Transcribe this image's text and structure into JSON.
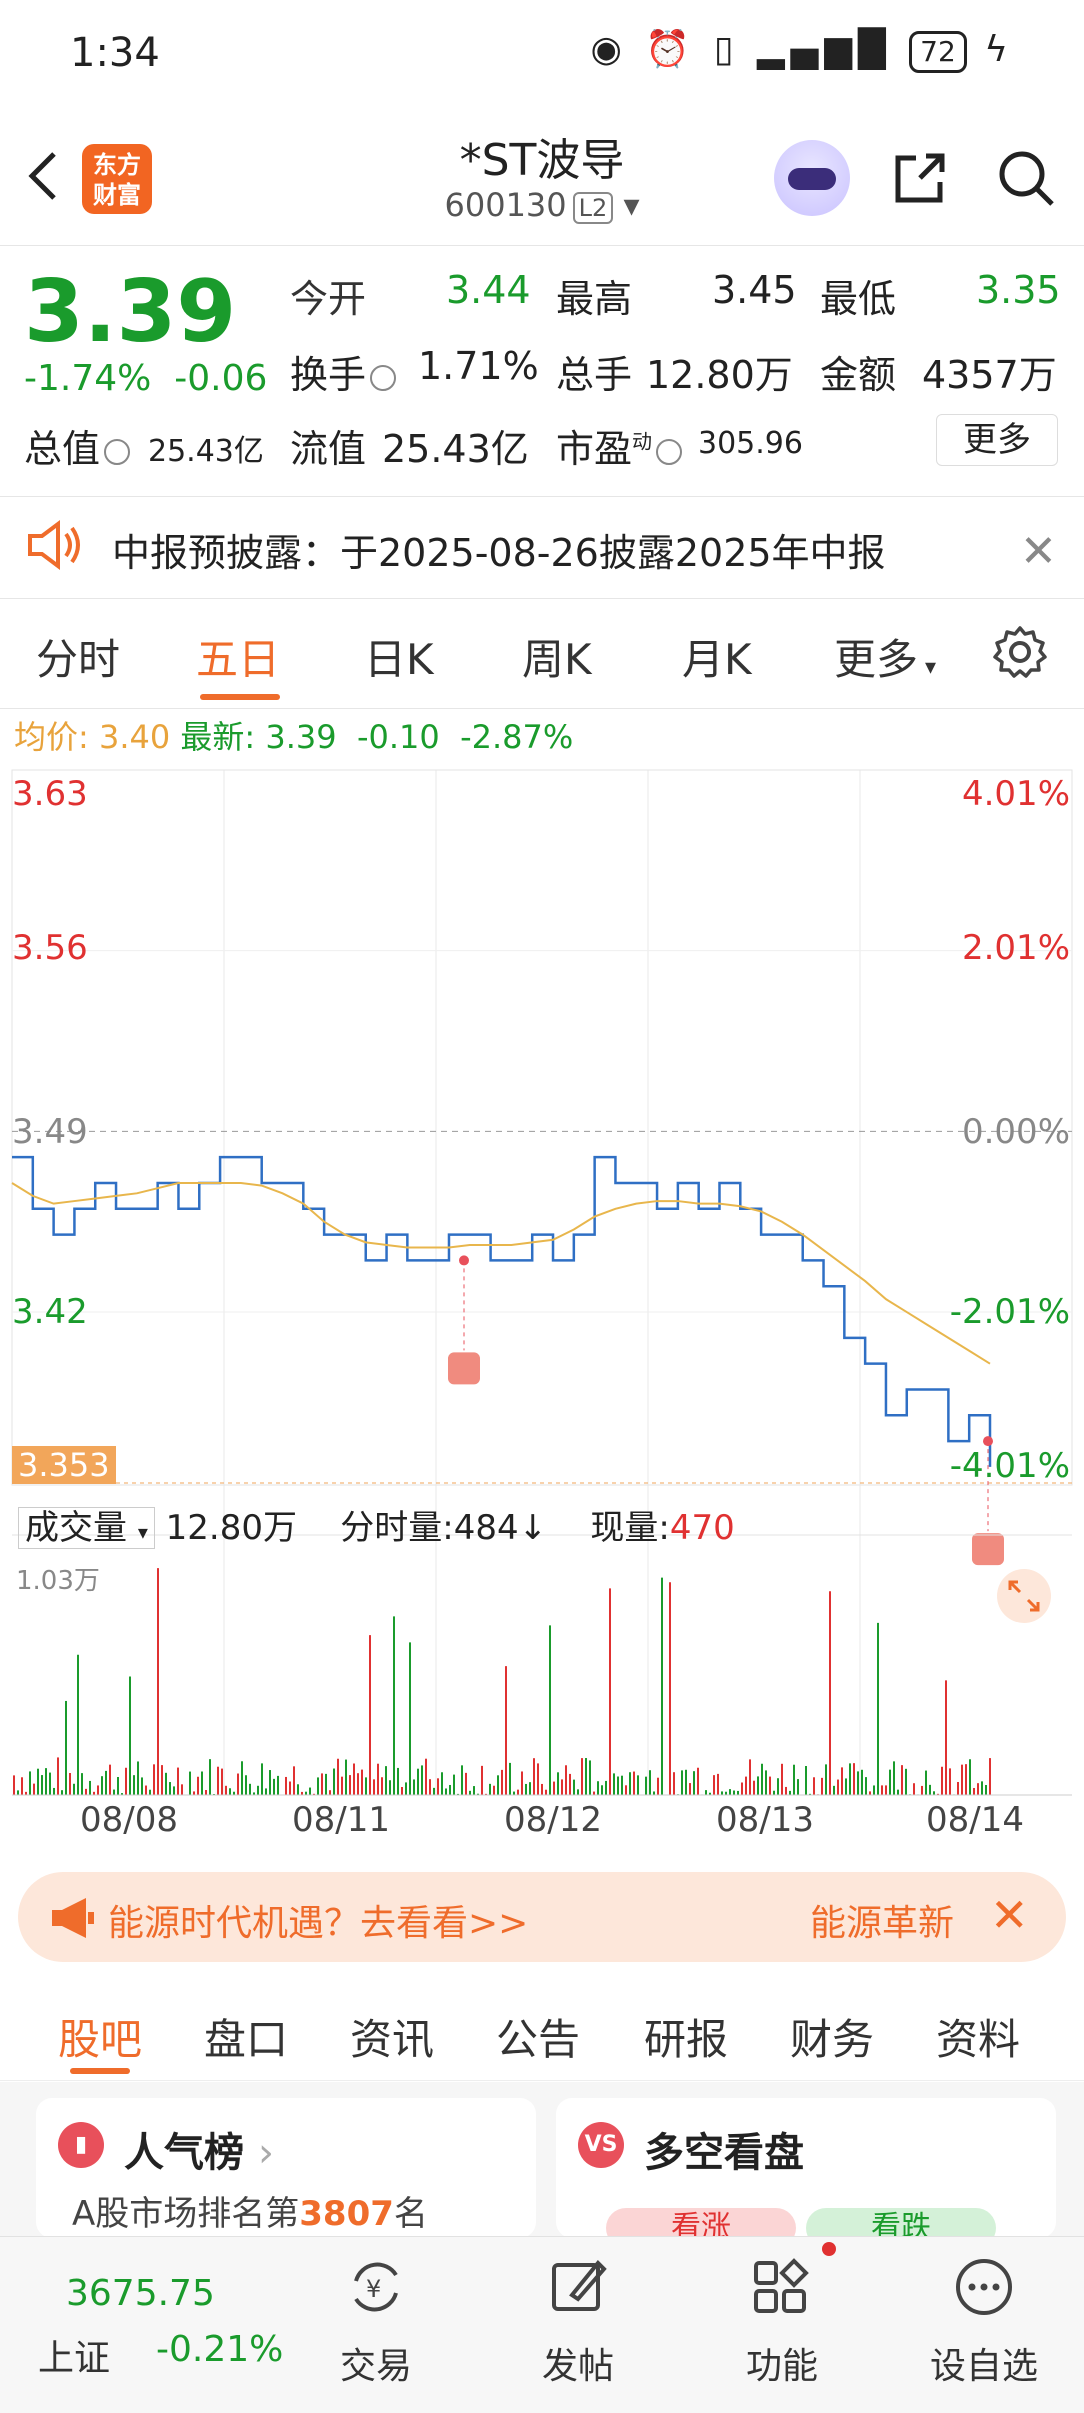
{
  "status_bar": {
    "time": "1:34",
    "battery": "72"
  },
  "header": {
    "title": "*ST波导",
    "code": "600130",
    "level_badge": "L2",
    "logo_line1": "东方",
    "logo_line2": "财富"
  },
  "quote": {
    "price": "3.39",
    "change_pct": "-1.74%",
    "change": "-0.06",
    "open_label": "今开",
    "open": "3.44",
    "high_label": "最高",
    "high": "3.45",
    "low_label": "最低",
    "low": "3.35",
    "turnover_label": "换手",
    "turnover": "1.71%",
    "volume_label": "总手",
    "volume": "12.80万",
    "amount_label": "金额",
    "amount": "4357万",
    "mktcap_label": "总值",
    "mktcap": "25.43亿",
    "float_label": "流值",
    "float": "25.43亿",
    "pe_label": "市盈",
    "pe_sup": "动",
    "pe": "305.96",
    "more": "更多"
  },
  "notice": {
    "text": "中报预披露：于2025-08-26披露2025年中报"
  },
  "tabs": [
    "分时",
    "五日",
    "日K",
    "周K",
    "月K",
    "更多"
  ],
  "chart_info": {
    "avg_label": "均价:",
    "avg": "3.40",
    "latest_label": "最新:",
    "latest": "3.39",
    "chg": "-0.10",
    "pct": "-2.87%"
  },
  "chart_data": {
    "type": "line",
    "y_left_ticks": [
      "3.63",
      "3.56",
      "3.49",
      "3.42",
      "3.353"
    ],
    "y_right_ticks": [
      "4.01%",
      "2.01%",
      "0.00%",
      "-2.01%",
      "-4.01%"
    ],
    "x_labels": [
      "08/08",
      "08/11",
      "08/12",
      "08/13",
      "08/14"
    ],
    "ylim": [
      3.353,
      3.63
    ],
    "prev_close": 3.49,
    "series": [
      {
        "values": [
          3.48,
          3.46,
          3.45,
          3.46,
          3.47,
          3.46,
          3.46,
          3.47,
          3.46,
          3.47,
          3.48,
          3.48,
          3.47,
          3.47,
          3.46,
          3.45,
          3.45,
          3.44,
          3.45,
          3.44,
          3.44,
          3.45,
          3.45,
          3.44,
          3.44,
          3.45,
          3.44,
          3.45,
          3.48,
          3.47,
          3.47,
          3.46,
          3.47,
          3.46,
          3.47,
          3.46,
          3.45,
          3.45,
          3.44,
          3.43,
          3.41,
          3.4,
          3.38,
          3.39,
          3.39,
          3.37,
          3.38,
          3.36
        ]
      },
      {
        "values": [
          3.47,
          3.465,
          3.462,
          3.463,
          3.464,
          3.465,
          3.466,
          3.468,
          3.47,
          3.47,
          3.47,
          3.47,
          3.469,
          3.466,
          3.462,
          3.455,
          3.45,
          3.447,
          3.446,
          3.445,
          3.445,
          3.445,
          3.446,
          3.446,
          3.446,
          3.447,
          3.448,
          3.452,
          3.457,
          3.46,
          3.462,
          3.463,
          3.463,
          3.462,
          3.462,
          3.461,
          3.459,
          3.455,
          3.45,
          3.444,
          3.438,
          3.432,
          3.425,
          3.42,
          3.415,
          3.41,
          3.405,
          3.4
        ]
      }
    ],
    "volume_max_label": "1.03万"
  },
  "vol_info": {
    "selector": "成交量",
    "total": "12.80万",
    "tick_label": "分时量:",
    "tick": "484",
    "arrow": "↓",
    "now_label": "现量:",
    "now": "470"
  },
  "banner": {
    "text": "能源时代机遇？去看看>>",
    "right": "能源革新"
  },
  "bottom_tabs": [
    "股吧",
    "盘口",
    "资讯",
    "公告",
    "研报",
    "财务",
    "资料"
  ],
  "cards": {
    "popular_title": "人气榜",
    "popular_sub_prefix": "A股市场排名第",
    "popular_rank": "3807",
    "popular_sub_suffix": "名",
    "duokong_title": "多空看盘",
    "vote_up": "看涨",
    "vote_down": "看跌",
    "vs": "VS"
  },
  "bottom_nav": {
    "index_value": "3675.75",
    "index_name": "上证",
    "index_chg": "-0.21%",
    "trade": "交易",
    "post": "发帖",
    "func": "功能",
    "watch": "设自选"
  },
  "colors": {
    "accent": "#ef6c2b",
    "up": "#e03131",
    "down": "#1a9b2c",
    "price_line": "#2f6fc4",
    "avg_line": "#e8b64c"
  }
}
